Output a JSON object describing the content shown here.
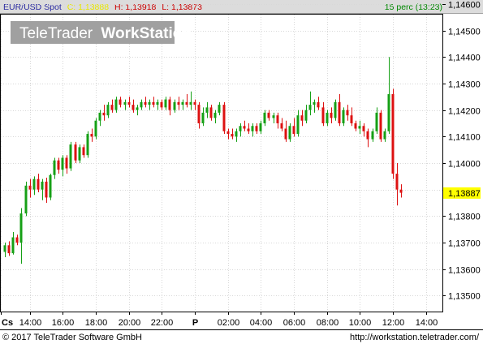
{
  "header": {
    "symbol": "EUR/USD Spot",
    "close_prefix": "C: ",
    "close_value": "1,13888",
    "high_text": "H: 1,13918",
    "low_text": "L: 1,13873",
    "interval_text": "15 perc (13:23)"
  },
  "watermark": {
    "brand": "TeleTrader",
    "product": "WorkStation"
  },
  "last_price_label": "1,13887",
  "footer": {
    "copyright": "© 2017 TeleTrader Software GmbH",
    "url": "http://workstation.teletrader.com/"
  },
  "colors": {
    "up": "#16a016",
    "down": "#dd1111",
    "grid": "#d8d8d8",
    "header_bg": "#dcdcdc",
    "last_price_bg": "#ffff00",
    "close_value_color": "#e8e800",
    "high_low_color": "#cc0000",
    "interval_color": "#008800"
  },
  "chart_data": {
    "type": "candlestick",
    "y_axis_side": "right",
    "ylim": [
      1.1344,
      1.1456
    ],
    "y_ticks": [
      "1,13500",
      "1,13600",
      "1,13700",
      "1,13800",
      "1,13900",
      "1,14000",
      "1,14100",
      "1,14200",
      "1,14300",
      "1,14400",
      "1,14500",
      "1,14600"
    ],
    "x_tick_labels": [
      "Cs",
      "14:00",
      "16:00",
      "18:00",
      "20:00",
      "22:00",
      "P",
      "02:00",
      "04:00",
      "06:00",
      "08:00",
      "10:00",
      "12:00",
      "14:00"
    ],
    "x_tick_bold": [
      "Cs",
      "P"
    ],
    "x_range": [
      -1,
      106
    ],
    "x_tick_positions": [
      -1,
      6,
      14,
      22,
      30,
      38,
      46,
      54,
      62,
      70,
      78,
      86,
      94,
      102
    ],
    "grid": true,
    "candles": [
      {
        "o": 1.13665,
        "h": 1.137,
        "l": 1.13645,
        "c": 1.1369
      },
      {
        "o": 1.1369,
        "h": 1.13705,
        "l": 1.1365,
        "c": 1.1366
      },
      {
        "o": 1.1366,
        "h": 1.1374,
        "l": 1.13655,
        "c": 1.1372
      },
      {
        "o": 1.1372,
        "h": 1.1373,
        "l": 1.1369,
        "c": 1.137
      },
      {
        "o": 1.137,
        "h": 1.1383,
        "l": 1.1362,
        "c": 1.1381
      },
      {
        "o": 1.1381,
        "h": 1.1393,
        "l": 1.138,
        "c": 1.13915
      },
      {
        "o": 1.13915,
        "h": 1.1394,
        "l": 1.1387,
        "c": 1.139
      },
      {
        "o": 1.139,
        "h": 1.1395,
        "l": 1.1388,
        "c": 1.1394
      },
      {
        "o": 1.1394,
        "h": 1.1396,
        "l": 1.1389,
        "c": 1.139
      },
      {
        "o": 1.139,
        "h": 1.1394,
        "l": 1.1386,
        "c": 1.1393
      },
      {
        "o": 1.1393,
        "h": 1.13945,
        "l": 1.1385,
        "c": 1.1387
      },
      {
        "o": 1.1387,
        "h": 1.1396,
        "l": 1.1386,
        "c": 1.13955
      },
      {
        "o": 1.13955,
        "h": 1.1402,
        "l": 1.1394,
        "c": 1.1401
      },
      {
        "o": 1.1401,
        "h": 1.1402,
        "l": 1.1396,
        "c": 1.13975
      },
      {
        "o": 1.13975,
        "h": 1.1403,
        "l": 1.1395,
        "c": 1.1402
      },
      {
        "o": 1.1402,
        "h": 1.1403,
        "l": 1.1396,
        "c": 1.1398
      },
      {
        "o": 1.1398,
        "h": 1.1408,
        "l": 1.1397,
        "c": 1.1407
      },
      {
        "o": 1.1407,
        "h": 1.1408,
        "l": 1.14,
        "c": 1.1401
      },
      {
        "o": 1.1401,
        "h": 1.1407,
        "l": 1.14,
        "c": 1.1406
      },
      {
        "o": 1.1406,
        "h": 1.1407,
        "l": 1.1402,
        "c": 1.1403
      },
      {
        "o": 1.1403,
        "h": 1.1412,
        "l": 1.1402,
        "c": 1.1411
      },
      {
        "o": 1.1411,
        "h": 1.1413,
        "l": 1.1408,
        "c": 1.141
      },
      {
        "o": 1.141,
        "h": 1.1417,
        "l": 1.1409,
        "c": 1.1416
      },
      {
        "o": 1.1416,
        "h": 1.142,
        "l": 1.1414,
        "c": 1.1419
      },
      {
        "o": 1.1419,
        "h": 1.1422,
        "l": 1.1416,
        "c": 1.1418
      },
      {
        "o": 1.1418,
        "h": 1.1423,
        "l": 1.1417,
        "c": 1.1422
      },
      {
        "o": 1.1422,
        "h": 1.1424,
        "l": 1.1419,
        "c": 1.142
      },
      {
        "o": 1.142,
        "h": 1.1425,
        "l": 1.1419,
        "c": 1.1424
      },
      {
        "o": 1.1424,
        "h": 1.1425,
        "l": 1.1421,
        "c": 1.1422
      },
      {
        "o": 1.1422,
        "h": 1.1424,
        "l": 1.142,
        "c": 1.1423
      },
      {
        "o": 1.1423,
        "h": 1.1425,
        "l": 1.1421,
        "c": 1.1422
      },
      {
        "o": 1.1422,
        "h": 1.1424,
        "l": 1.1419,
        "c": 1.142
      },
      {
        "o": 1.142,
        "h": 1.1422,
        "l": 1.1418,
        "c": 1.1421
      },
      {
        "o": 1.1421,
        "h": 1.1424,
        "l": 1.142,
        "c": 1.1423
      },
      {
        "o": 1.1423,
        "h": 1.1425,
        "l": 1.1421,
        "c": 1.1422
      },
      {
        "o": 1.1422,
        "h": 1.1424,
        "l": 1.142,
        "c": 1.1423
      },
      {
        "o": 1.1423,
        "h": 1.1425,
        "l": 1.1421,
        "c": 1.1422
      },
      {
        "o": 1.1422,
        "h": 1.1424,
        "l": 1.142,
        "c": 1.1423
      },
      {
        "o": 1.1423,
        "h": 1.1424,
        "l": 1.142,
        "c": 1.1421
      },
      {
        "o": 1.1421,
        "h": 1.1425,
        "l": 1.142,
        "c": 1.1424
      },
      {
        "o": 1.1424,
        "h": 1.1425,
        "l": 1.1418,
        "c": 1.142
      },
      {
        "o": 1.142,
        "h": 1.1424,
        "l": 1.1419,
        "c": 1.1423
      },
      {
        "o": 1.1423,
        "h": 1.1425,
        "l": 1.142,
        "c": 1.1422
      },
      {
        "o": 1.1422,
        "h": 1.1424,
        "l": 1.142,
        "c": 1.1423
      },
      {
        "o": 1.1423,
        "h": 1.1426,
        "l": 1.1421,
        "c": 1.1422
      },
      {
        "o": 1.1422,
        "h": 1.1427,
        "l": 1.142,
        "c": 1.1423
      },
      {
        "o": 1.1423,
        "h": 1.1424,
        "l": 1.142,
        "c": 1.1422
      },
      {
        "o": 1.1422,
        "h": 1.1423,
        "l": 1.1413,
        "c": 1.1415
      },
      {
        "o": 1.1415,
        "h": 1.1421,
        "l": 1.1414,
        "c": 1.1419
      },
      {
        "o": 1.1419,
        "h": 1.1423,
        "l": 1.1417,
        "c": 1.1421
      },
      {
        "o": 1.1421,
        "h": 1.1422,
        "l": 1.1416,
        "c": 1.1417
      },
      {
        "o": 1.1417,
        "h": 1.142,
        "l": 1.1415,
        "c": 1.1419
      },
      {
        "o": 1.1419,
        "h": 1.1423,
        "l": 1.1418,
        "c": 1.1422
      },
      {
        "o": 1.1422,
        "h": 1.1423,
        "l": 1.1411,
        "c": 1.1412
      },
      {
        "o": 1.1412,
        "h": 1.1413,
        "l": 1.1409,
        "c": 1.1411
      },
      {
        "o": 1.1411,
        "h": 1.1413,
        "l": 1.1409,
        "c": 1.141
      },
      {
        "o": 1.141,
        "h": 1.1413,
        "l": 1.1408,
        "c": 1.1412
      },
      {
        "o": 1.1412,
        "h": 1.1415,
        "l": 1.141,
        "c": 1.1414
      },
      {
        "o": 1.1414,
        "h": 1.1416,
        "l": 1.1412,
        "c": 1.1413
      },
      {
        "o": 1.1413,
        "h": 1.1415,
        "l": 1.1411,
        "c": 1.1412
      },
      {
        "o": 1.1412,
        "h": 1.1415,
        "l": 1.141,
        "c": 1.1414
      },
      {
        "o": 1.1414,
        "h": 1.1415,
        "l": 1.1411,
        "c": 1.1412
      },
      {
        "o": 1.1412,
        "h": 1.1416,
        "l": 1.1411,
        "c": 1.1415
      },
      {
        "o": 1.1415,
        "h": 1.142,
        "l": 1.1414,
        "c": 1.1419
      },
      {
        "o": 1.1419,
        "h": 1.142,
        "l": 1.1416,
        "c": 1.1417
      },
      {
        "o": 1.1417,
        "h": 1.1419,
        "l": 1.1415,
        "c": 1.1418
      },
      {
        "o": 1.1418,
        "h": 1.1419,
        "l": 1.1413,
        "c": 1.1415
      },
      {
        "o": 1.1415,
        "h": 1.1417,
        "l": 1.1412,
        "c": 1.1413
      },
      {
        "o": 1.1413,
        "h": 1.1416,
        "l": 1.1408,
        "c": 1.1409
      },
      {
        "o": 1.1409,
        "h": 1.1415,
        "l": 1.1408,
        "c": 1.1414
      },
      {
        "o": 1.1414,
        "h": 1.1417,
        "l": 1.141,
        "c": 1.1411
      },
      {
        "o": 1.1411,
        "h": 1.142,
        "l": 1.141,
        "c": 1.1418
      },
      {
        "o": 1.1418,
        "h": 1.142,
        "l": 1.1414,
        "c": 1.1416
      },
      {
        "o": 1.1416,
        "h": 1.1422,
        "l": 1.1415,
        "c": 1.142
      },
      {
        "o": 1.142,
        "h": 1.1427,
        "l": 1.1418,
        "c": 1.1422
      },
      {
        "o": 1.1422,
        "h": 1.1424,
        "l": 1.1419,
        "c": 1.1423
      },
      {
        "o": 1.1423,
        "h": 1.1425,
        "l": 1.142,
        "c": 1.1421
      },
      {
        "o": 1.1421,
        "h": 1.1423,
        "l": 1.1414,
        "c": 1.1415
      },
      {
        "o": 1.1415,
        "h": 1.142,
        "l": 1.1414,
        "c": 1.1419
      },
      {
        "o": 1.1419,
        "h": 1.1421,
        "l": 1.1415,
        "c": 1.1417
      },
      {
        "o": 1.1417,
        "h": 1.1424,
        "l": 1.1416,
        "c": 1.1423
      },
      {
        "o": 1.1423,
        "h": 1.1426,
        "l": 1.1414,
        "c": 1.1415
      },
      {
        "o": 1.1415,
        "h": 1.1421,
        "l": 1.1414,
        "c": 1.142
      },
      {
        "o": 1.142,
        "h": 1.1422,
        "l": 1.1416,
        "c": 1.1418
      },
      {
        "o": 1.1418,
        "h": 1.1421,
        "l": 1.1414,
        "c": 1.1415
      },
      {
        "o": 1.1415,
        "h": 1.1416,
        "l": 1.1412,
        "c": 1.1413
      },
      {
        "o": 1.1413,
        "h": 1.1416,
        "l": 1.1411,
        "c": 1.1414
      },
      {
        "o": 1.1414,
        "h": 1.1415,
        "l": 1.141,
        "c": 1.1412
      },
      {
        "o": 1.1412,
        "h": 1.1413,
        "l": 1.1406,
        "c": 1.1409
      },
      {
        "o": 1.1409,
        "h": 1.1413,
        "l": 1.1408,
        "c": 1.1412
      },
      {
        "o": 1.1412,
        "h": 1.1421,
        "l": 1.1411,
        "c": 1.1419
      },
      {
        "o": 1.1419,
        "h": 1.142,
        "l": 1.1408,
        "c": 1.1409
      },
      {
        "o": 1.1409,
        "h": 1.1413,
        "l": 1.1408,
        "c": 1.1412
      },
      {
        "o": 1.1412,
        "h": 1.144,
        "l": 1.1411,
        "c": 1.1426
      },
      {
        "o": 1.1426,
        "h": 1.1428,
        "l": 1.1394,
        "c": 1.1396
      },
      {
        "o": 1.1396,
        "h": 1.14,
        "l": 1.1384,
        "c": 1.139
      },
      {
        "o": 1.139,
        "h": 1.1392,
        "l": 1.1387,
        "c": 1.13888
      }
    ]
  }
}
